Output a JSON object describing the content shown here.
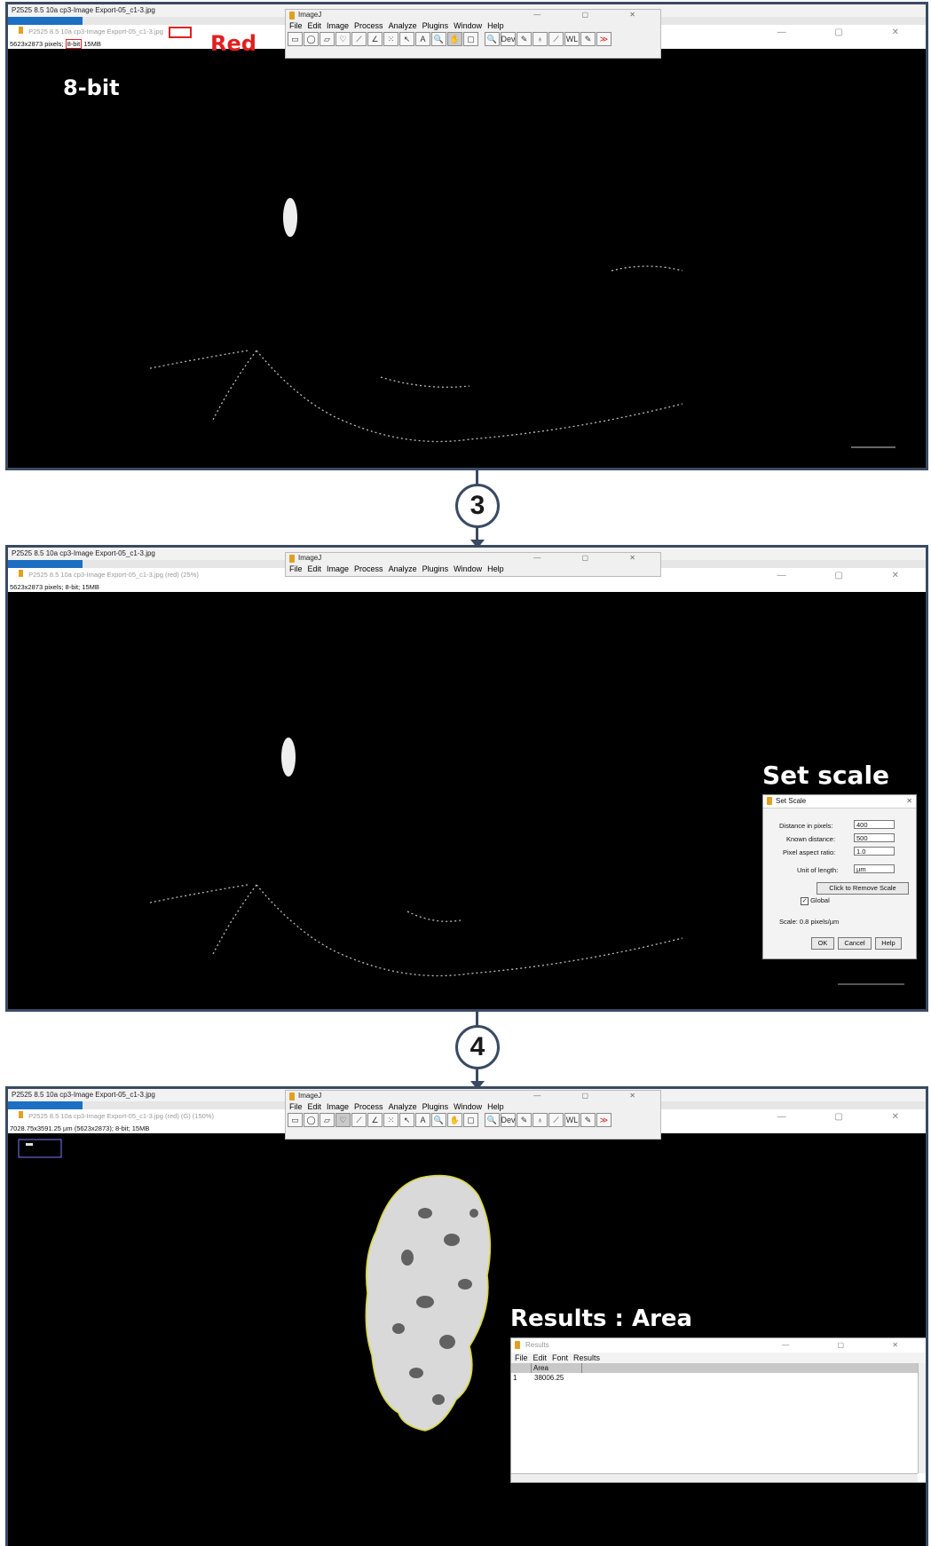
{
  "panel1": {
    "os_title": "P2525 8.5 10a cp3-Image Export-05_c1-3.jpg",
    "image_title": "P2525 8.5 10a cp3-Image Export-05_c1-3.jpg",
    "info_prefix": "5623x2873 pixels;",
    "info_bit": "8-bit",
    "info_suffix": "15MB",
    "callout_red": "Red",
    "callout_8bit": "8-bit"
  },
  "imagej": {
    "title": "ImageJ",
    "menu": [
      "File",
      "Edit",
      "Image",
      "Process",
      "Analyze",
      "Plugins",
      "Window",
      "Help"
    ],
    "tools": [
      "▭",
      "◯",
      "▱",
      "♡",
      "⟋",
      "∠",
      "⁙",
      "↖",
      "A",
      "🔍",
      "✋",
      "▢",
      "🔍",
      "Dev",
      "✎",
      "♁",
      "⟋",
      "WL",
      "✎",
      "≫"
    ]
  },
  "step3": "3",
  "panel2": {
    "os_title": "P2525 8.5 10a cp3-Image Export-05_c1-3.jpg",
    "image_title": "P2525 8.5 10a cp3-Image Export-05_c1-3.jpg (red) (25%)",
    "info": "5623x2873 pixels; 8-bit; 15MB",
    "callout": "Set scale",
    "dialog": {
      "title": "Set Scale",
      "distance_pixels_label": "Distance in pixels:",
      "distance_pixels_value": "400",
      "known_distance_label": "Known distance:",
      "known_distance_value": "500",
      "aspect_label": "Pixel aspect ratio:",
      "aspect_value": "1.0",
      "unit_label": "Unit of length:",
      "unit_value": "µm",
      "remove_button": "Click to Remove Scale",
      "global_label": "Global",
      "scale_text": "Scale: 0.8 pixels/µm",
      "ok": "OK",
      "cancel": "Cancel",
      "help": "Help"
    }
  },
  "step4": "4",
  "panel3": {
    "os_title": "P2525 8.5 10a cp3-Image Export-05_c1-3.jpg",
    "image_title": "P2525 8.5 10a cp3-Image Export-05_c1-3.jpg (red) (G) (150%)",
    "info": "7028.75x3591.25 µm (5623x2873); 8-bit; 15MB",
    "callout": "Results : Area",
    "results": {
      "title": "Results",
      "menu": [
        "File",
        "Edit",
        "Font",
        "Results"
      ],
      "col_header": "Area",
      "row_index": "1",
      "row_value": "38006.25"
    }
  }
}
